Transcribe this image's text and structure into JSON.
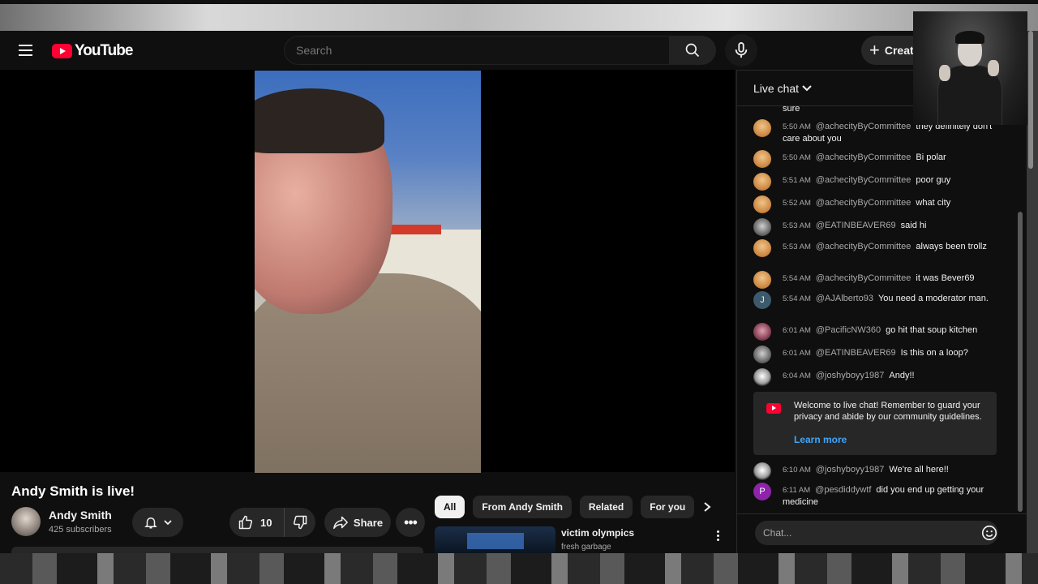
{
  "masthead": {
    "logo_text": "YouTube",
    "search_placeholder": "Search",
    "create_label": "Create",
    "icons": [
      "menu-icon",
      "search-icon",
      "mic-icon",
      "plus-icon"
    ]
  },
  "video": {
    "title": "Andy Smith is live!",
    "channel_name": "Andy Smith",
    "subscribers": "425 subscribers",
    "like_count": "10",
    "share_label": "Share"
  },
  "chips": [
    "All",
    "From Andy Smith",
    "Related",
    "For you"
  ],
  "recommendation": {
    "title": "victim olympics",
    "channel": "fresh garbage"
  },
  "chat": {
    "header": "Live chat",
    "partial_top_text": "sure",
    "messages": [
      {
        "time": "5:50 AM",
        "author": "@achecityByCommittee",
        "text": "they definitely don't care about you",
        "avatar": "orange"
      },
      {
        "time": "5:50 AM",
        "author": "@achecityByCommittee",
        "text": "Bi polar",
        "avatar": "orange"
      },
      {
        "time": "5:51 AM",
        "author": "@achecityByCommittee",
        "text": "poor guy",
        "avatar": "orange"
      },
      {
        "time": "5:52 AM",
        "author": "@achecityByCommittee",
        "text": "what city",
        "avatar": "orange"
      },
      {
        "time": "5:53 AM",
        "author": "@EATINBEAVER69",
        "text": "said hi",
        "avatar": "grey"
      },
      {
        "time": "5:53 AM",
        "author": "@achecityByCommittee",
        "text": "always been trollz",
        "avatar": "orange"
      },
      {
        "time": "5:54 AM",
        "author": "@achecityByCommittee",
        "text": "it was Bever69",
        "avatar": "orange"
      },
      {
        "time": "5:54 AM",
        "author": "@AJAlberto93",
        "text": "You need a moderator man.",
        "avatar": "J"
      },
      {
        "time": "6:01 AM",
        "author": "@PacificNW360",
        "text": "go hit that soup kitchen",
        "avatar": "pink"
      },
      {
        "time": "6:01 AM",
        "author": "@EATINBEAVER69",
        "text": "Is this on a loop?",
        "avatar": "grey"
      },
      {
        "time": "6:04 AM",
        "author": "@joshyboyy1987",
        "text": "Andy!!",
        "avatar": "skull"
      },
      {
        "time": "6:10 AM",
        "author": "@joshyboyy1987",
        "text": "We're all here!!",
        "avatar": "skull"
      },
      {
        "time": "6:11 AM",
        "author": "@pesdiddywtf",
        "text": "did you end up getting your medicine",
        "avatar": "P"
      }
    ],
    "welcome_text": "Welcome to live chat! Remember to guard your privacy and abide by our community guidelines.",
    "learn_more": "Learn more",
    "input_placeholder": "Chat..."
  },
  "colors": {
    "brand_red": "#ff0033",
    "link_blue": "#3ea6ff",
    "background": "#0f0f0f"
  }
}
